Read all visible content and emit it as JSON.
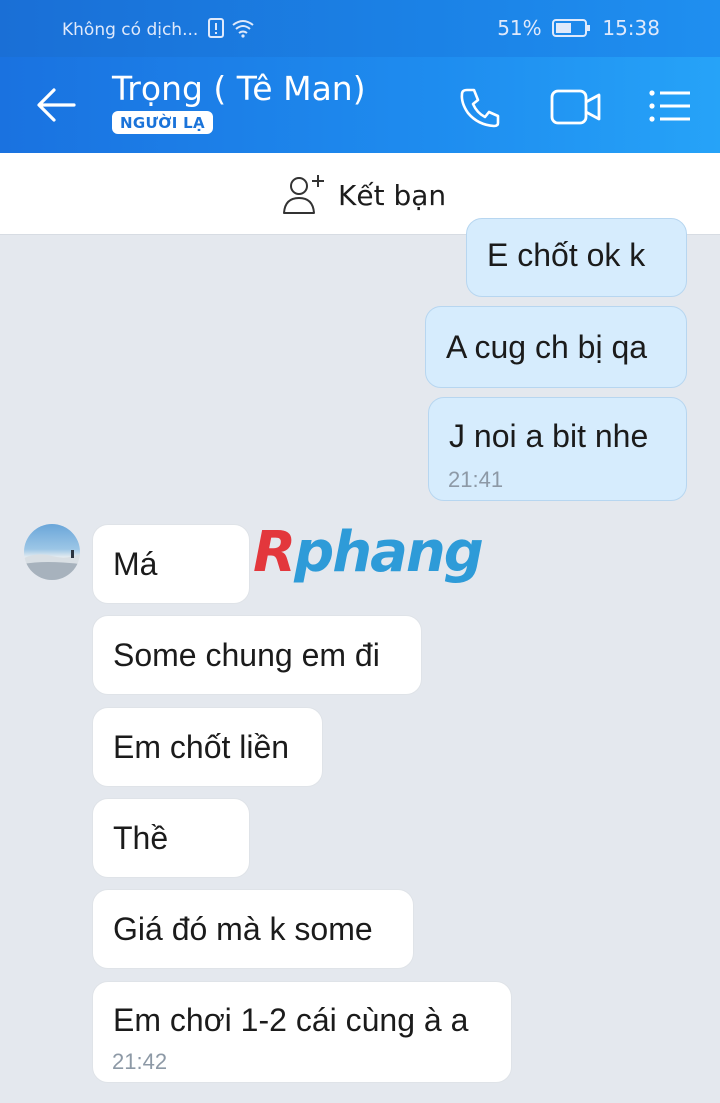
{
  "status_bar": {
    "carrier": "Không có dịch...",
    "battery": "51%",
    "time": "15:38"
  },
  "header": {
    "contact_name": "Trọng ( Tê Man)",
    "badge": "NGƯỜI LẠ"
  },
  "friend_bar": {
    "label": "Kết bạn"
  },
  "watermark": {
    "first": "R",
    "rest": "phang"
  },
  "messages_out": [
    {
      "text": "E chốt ok k"
    },
    {
      "text": "A cug ch bị qa"
    },
    {
      "text": "J noi a bit nhe",
      "time": "21:41"
    }
  ],
  "messages_in": [
    {
      "text": "Má"
    },
    {
      "text": "Some chung em đi"
    },
    {
      "text": "Em chốt liền"
    },
    {
      "text": "Thề"
    },
    {
      "text": "Giá đó mà k some"
    },
    {
      "text": "Em chơi 1-2 cái cùng à a",
      "time": "21:42"
    }
  ]
}
